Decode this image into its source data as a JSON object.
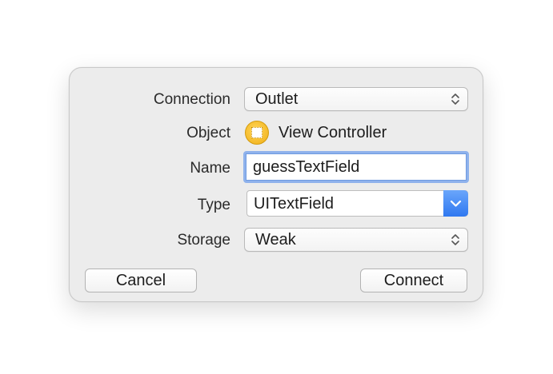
{
  "dialog": {
    "connection_label": "Connection",
    "connection_value": "Outlet",
    "object_label": "Object",
    "object_value": "View Controller",
    "name_label": "Name",
    "name_value": "guessTextField",
    "type_label": "Type",
    "type_value": "UITextField",
    "storage_label": "Storage",
    "storage_value": "Weak",
    "cancel_label": "Cancel",
    "connect_label": "Connect"
  },
  "colors": {
    "accent": "#2f78f0",
    "focus_ring": "#8fb2ec",
    "object_icon": "#f0ae16"
  },
  "icons": {
    "connection_stepper": "updown-chevron-icon",
    "object": "view-controller-icon",
    "type_dropdown": "chevron-down-icon",
    "storage_stepper": "updown-chevron-icon"
  }
}
